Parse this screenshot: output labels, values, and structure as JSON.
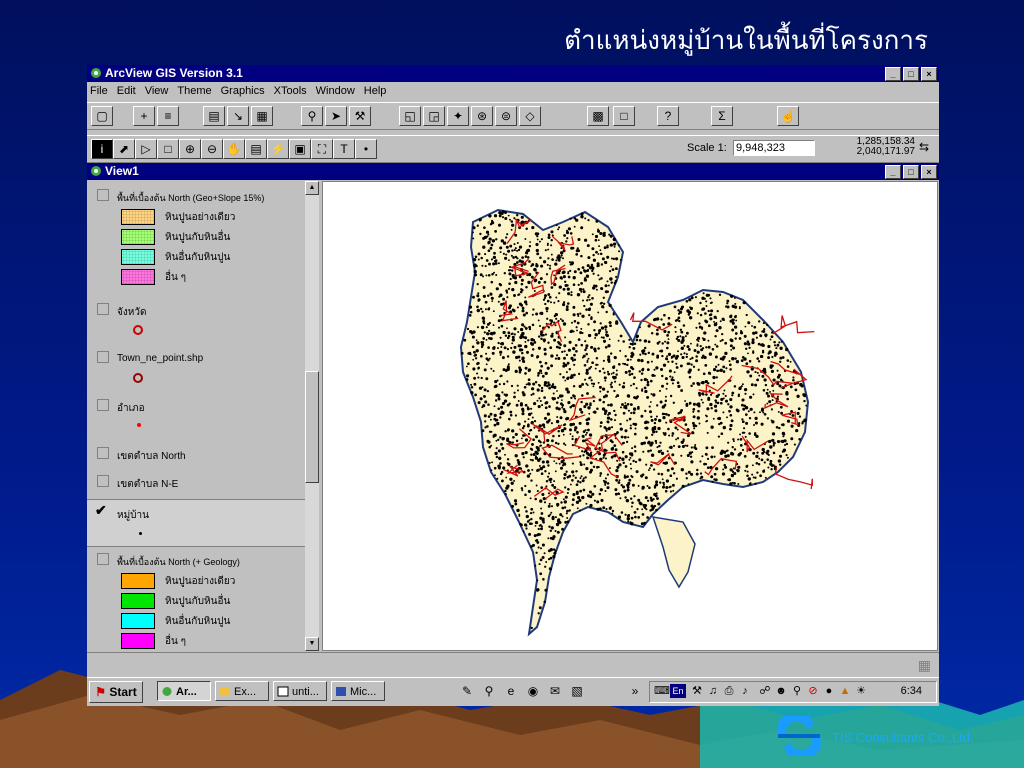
{
  "slide": {
    "title": "ตำแหน่งหมู่บ้านในพื้นที่โครงการ",
    "company": "TIS Consultants Co.,Ltd."
  },
  "app": {
    "title": "ArcView GIS Version 3.1",
    "menu": [
      "File",
      "Edit",
      "View",
      "Theme",
      "Graphics",
      "XTools",
      "Window",
      "Help"
    ],
    "scale_label": "Scale 1:",
    "scale_value": "9,948,323",
    "coord_x": "1,285,158.34",
    "coord_y": "2,040,171.97",
    "view_title": "View1"
  },
  "toc": {
    "themes": [
      {
        "name": "พื้นที่เบื้องต้น North (Geo+Slope 15%)",
        "checked": false,
        "legend": [
          {
            "label": "หินปูนอย่างเดียว",
            "color": "#ffd37f"
          },
          {
            "label": "หินปูนกับหินอื่น",
            "color": "#a3ff73"
          },
          {
            "label": "หินอื่นกับหินปูน",
            "color": "#73ffdf"
          },
          {
            "label": "อื่น ๆ",
            "color": "#ff73df"
          }
        ]
      },
      {
        "name": "จังหวัด",
        "checked": false,
        "symbol_color": "#cc0000"
      },
      {
        "name": "Town_ne_point.shp",
        "checked": false,
        "symbol_color": "#990000"
      },
      {
        "name": "อำเภอ",
        "checked": false,
        "symbol_color": "#ff0000"
      },
      {
        "name": "เขตตำบล North",
        "checked": false
      },
      {
        "name": "เขตตำบล N-E",
        "checked": false
      },
      {
        "name": "หมู่บ้าน",
        "checked": true,
        "symbol_color": "#000000"
      },
      {
        "name": "พื้นที่เบื้องต้น North (+ Geology)",
        "checked": false,
        "legend": [
          {
            "label": "หินปูนอย่างเดียว",
            "color": "#ffa500"
          },
          {
            "label": "หินปูนกับหินอื่น",
            "color": "#00e600"
          },
          {
            "label": "หินอื่นกับหินปูน",
            "color": "#00ffff"
          },
          {
            "label": "อื่น ๆ",
            "color": "#ff00ff"
          }
        ]
      }
    ]
  },
  "taskbar": {
    "start": "Start",
    "tasks": [
      "Ar...",
      "Ex...",
      "unti...",
      "Mic..."
    ],
    "tray_lang": "En",
    "clock": "6:34"
  },
  "colors": {
    "land": "#fdf3c8",
    "outline": "#1f3a7a",
    "roads": "#d01010",
    "villages": "#000000"
  }
}
